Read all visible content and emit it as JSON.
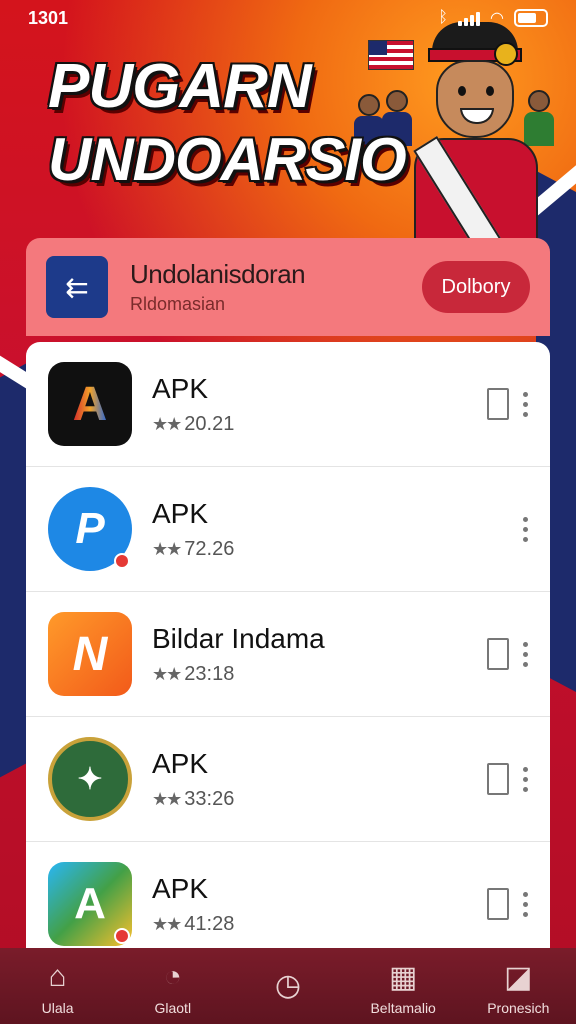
{
  "status_bar": {
    "time": "1301"
  },
  "banner": {
    "line1": "PUGARN",
    "line2": "UNDOARSIO"
  },
  "header_card": {
    "title": "Undolanisdoran",
    "subtitle": "Rldomasian",
    "button_label": "Dolbory"
  },
  "apps": [
    {
      "name": "APK",
      "rating_value": "20.21",
      "icon": "a-logo-icon",
      "label": "A",
      "show_doc": true,
      "badge": false
    },
    {
      "name": "APK",
      "rating_value": "72.26",
      "icon": "p-logo-icon",
      "label": "P",
      "show_doc": false,
      "badge": true
    },
    {
      "name": "Bildar Indama",
      "rating_value": "23:18",
      "icon": "n-logo-icon",
      "label": "N",
      "show_doc": true,
      "badge": false
    },
    {
      "name": "APK",
      "rating_value": "33:26",
      "icon": "seal-logo-icon",
      "label": "✦",
      "show_doc": true,
      "badge": false
    },
    {
      "name": "APK",
      "rating_value": "41:28",
      "icon": "arrow-logo-icon",
      "label": "A",
      "show_doc": true,
      "badge": true
    }
  ],
  "bottom_nav": [
    {
      "label": "Ulala",
      "icon": "home-icon"
    },
    {
      "label": "Glaotl",
      "icon": "search-icon"
    },
    {
      "label": "",
      "icon": "clock-icon"
    },
    {
      "label": "Beltamalio",
      "icon": "grid-icon"
    },
    {
      "label": "Pronesich",
      "icon": "profile-icon"
    }
  ],
  "colors": {
    "primary": "#c8102e",
    "navy": "#1d2a6b",
    "header_pink": "#f4797d",
    "button": "#c8283a"
  }
}
